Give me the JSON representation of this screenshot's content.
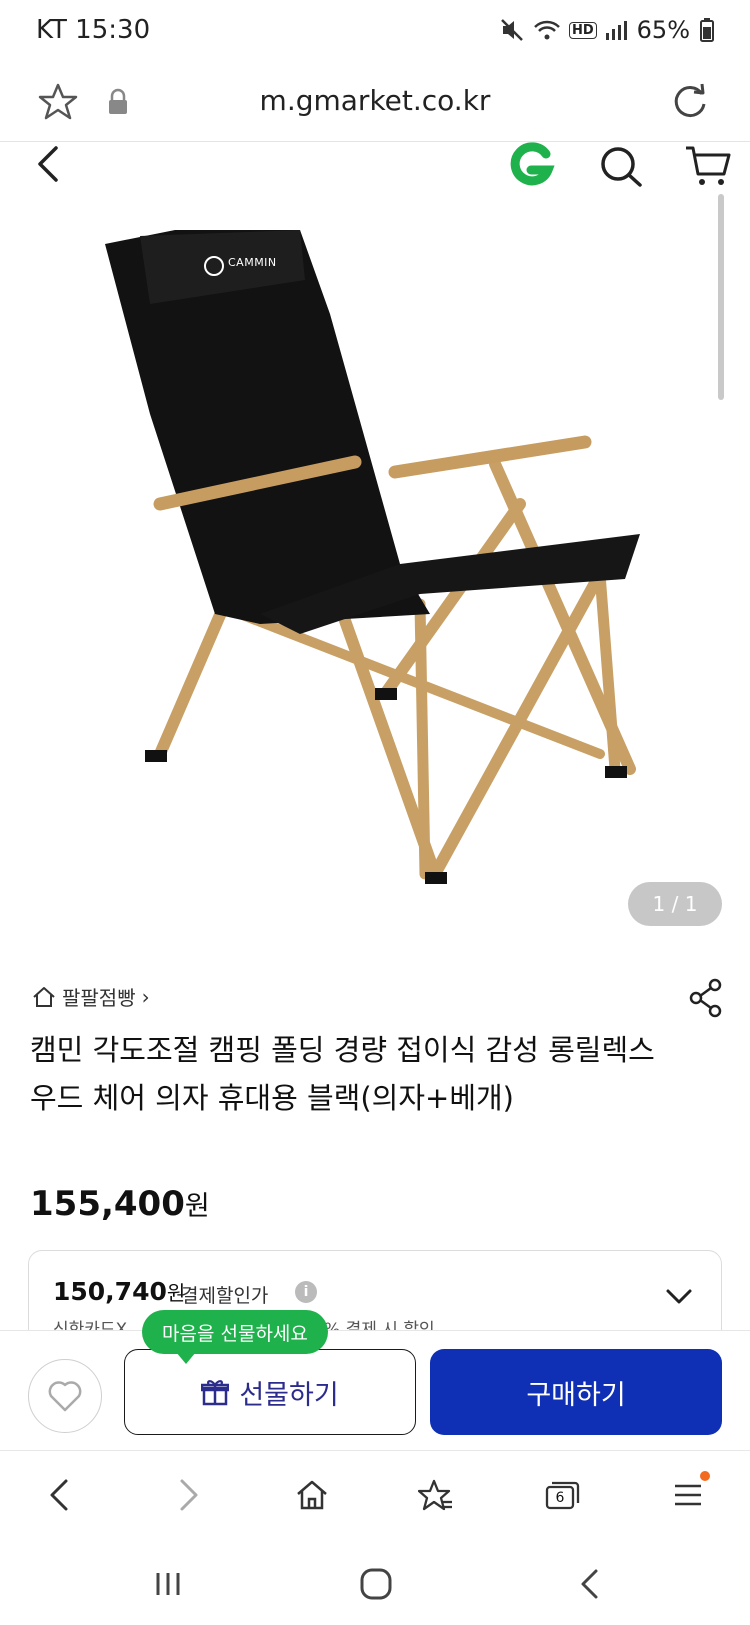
{
  "status_bar": {
    "carrier_time": "KT 15:30",
    "hd_badge": "HD",
    "battery": "65%"
  },
  "browser": {
    "url": "m.gmarket.co.kr"
  },
  "product": {
    "image_counter": "1 / 1",
    "store_name": "팔팔점빵",
    "store_chevron": "›",
    "title": "캠민 각도조절 캠핑 폴딩 경량 접이식 감성 롱릴렉스 우드 체어 의자 휴대용 블랙(의자+베개)",
    "price_number": "155,400",
    "price_unit": "원",
    "image_brand": "CAMMIN"
  },
  "discount": {
    "price_number": "150,740",
    "price_unit": "원",
    "label": "결제할인가",
    "info": "i",
    "sub_text_left": "신한카드X",
    "sub_text_right": "% 결제 시 할인"
  },
  "actions": {
    "gift_tooltip": "마음을 선물하세요",
    "gift_label": "선물하기",
    "buy_label": "구매하기"
  },
  "browser_nav": {
    "tabs_count": "6"
  },
  "colors": {
    "accent_blue": "#0f2fb4",
    "gift_text": "#2b2c8c",
    "tooltip_green": "#1fb14b",
    "g_logo_green": "#1fb14b",
    "notification_dot": "#f26b21"
  }
}
